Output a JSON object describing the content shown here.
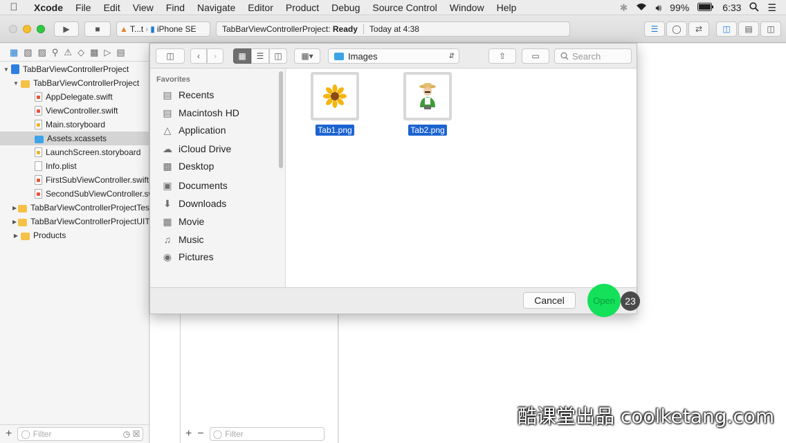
{
  "menubar": {
    "app": "Xcode",
    "items": [
      "File",
      "Edit",
      "View",
      "Find",
      "Navigate",
      "Editor",
      "Product",
      "Debug",
      "Source Control",
      "Window",
      "Help"
    ],
    "battery": "99%",
    "time": "6:33"
  },
  "toolbar": {
    "scheme_target": "T...t",
    "device": "iPhone SE",
    "activity_project": "TabBarViewControllerProject:",
    "activity_status": "Ready",
    "activity_time": "Today at 4:38"
  },
  "navigator": {
    "items": [
      {
        "label": "TabBarViewControllerProject",
        "type": "project",
        "level": 0,
        "disclosure": "open"
      },
      {
        "label": "TabBarViewControllerProject",
        "type": "folder",
        "level": 1,
        "disclosure": "open"
      },
      {
        "label": "AppDelegate.swift",
        "type": "swift",
        "level": 2
      },
      {
        "label": "ViewController.swift",
        "type": "swift",
        "level": 2
      },
      {
        "label": "Main.storyboard",
        "type": "storyboard",
        "level": 2
      },
      {
        "label": "Assets.xcassets",
        "type": "assets",
        "level": 2,
        "selected": true
      },
      {
        "label": "LaunchScreen.storyboard",
        "type": "storyboard",
        "level": 2
      },
      {
        "label": "Info.plist",
        "type": "plist",
        "level": 2
      },
      {
        "label": "FirstSubViewController.swift",
        "type": "swift",
        "level": 2
      },
      {
        "label": "SecondSubViewController.sw",
        "type": "swift",
        "level": 2
      },
      {
        "label": "TabBarViewControllerProjectTes",
        "type": "folder",
        "level": 1,
        "disclosure": "closed"
      },
      {
        "label": "TabBarViewControllerProjectUIT",
        "type": "folder",
        "level": 1,
        "disclosure": "closed"
      },
      {
        "label": "Products",
        "type": "folder",
        "level": 1,
        "disclosure": "closed"
      }
    ],
    "filter_placeholder": "Filter"
  },
  "middle": {
    "filter_placeholder": "Filter"
  },
  "open_panel": {
    "location": "Images",
    "search_placeholder": "Search",
    "favorites_header": "Favorites",
    "favorites": [
      {
        "label": "Recents",
        "icon": "clock-icon"
      },
      {
        "label": "Macintosh HD",
        "icon": "harddisk-icon"
      },
      {
        "label": "Application",
        "icon": "application-icon"
      },
      {
        "label": "iCloud Drive",
        "icon": "cloud-icon"
      },
      {
        "label": "Desktop",
        "icon": "desktop-icon"
      },
      {
        "label": "Documents",
        "icon": "document-icon"
      },
      {
        "label": "Downloads",
        "icon": "download-icon"
      },
      {
        "label": "Movie",
        "icon": "film-icon"
      },
      {
        "label": "Music",
        "icon": "music-icon"
      },
      {
        "label": "Pictures",
        "icon": "camera-icon"
      }
    ],
    "files": [
      {
        "name": "Tab1.png",
        "icon": "sunflower-icon",
        "selected": true
      },
      {
        "name": "Tab2.png",
        "icon": "farmer-icon",
        "selected": true
      }
    ],
    "cancel_label": "Cancel",
    "open_label": "Open",
    "click_badge": "23"
  },
  "watermark": "酷课堂出品 coolketang.com"
}
